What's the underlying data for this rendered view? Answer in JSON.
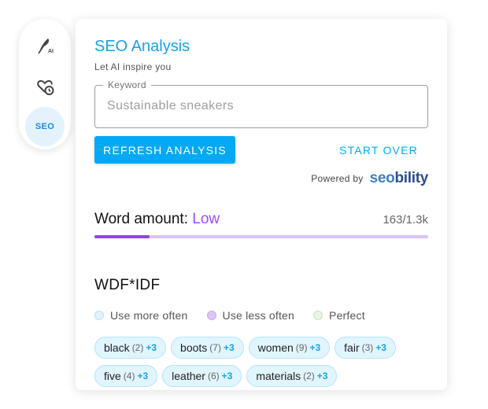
{
  "rail": {
    "ai_badge": "AI",
    "seo_label": "SEO"
  },
  "panel": {
    "title": "SEO Analysis",
    "subtitle": "Let AI inspire you"
  },
  "keyword": {
    "label": "Keyword",
    "value": "Sustainable sneakers"
  },
  "actions": {
    "refresh_label": "REFRESH ANALYSIS",
    "start_over_label": "START OVER"
  },
  "powered_by": {
    "text": "Powered by",
    "brand_prefix": "seo",
    "brand_suffix": "bility"
  },
  "word_amount": {
    "label": "Word amount:",
    "value": "Low",
    "count": "163/1.3k",
    "progress_fraction": 0.165
  },
  "wdf": {
    "title": "WDF*IDF",
    "legend": [
      "Use more often",
      "Use less often",
      "Perfect"
    ],
    "terms": [
      {
        "word": "black",
        "count": "(2)",
        "delta": "+3"
      },
      {
        "word": "boots",
        "count": "(7)",
        "delta": "+3"
      },
      {
        "word": "women",
        "count": "(9)",
        "delta": "+3"
      },
      {
        "word": "fair",
        "count": "(3)",
        "delta": "+3"
      },
      {
        "word": "five",
        "count": "(4)",
        "delta": "+3"
      },
      {
        "word": "leather",
        "count": "(6)",
        "delta": "+3"
      },
      {
        "word": "materials",
        "count": "(2)",
        "delta": "+3"
      }
    ]
  },
  "colors": {
    "accent": "#03a9f4",
    "low": "#9c4dff",
    "bar_track": "#d9c2f7",
    "bar_fill": "#8e44ec"
  }
}
